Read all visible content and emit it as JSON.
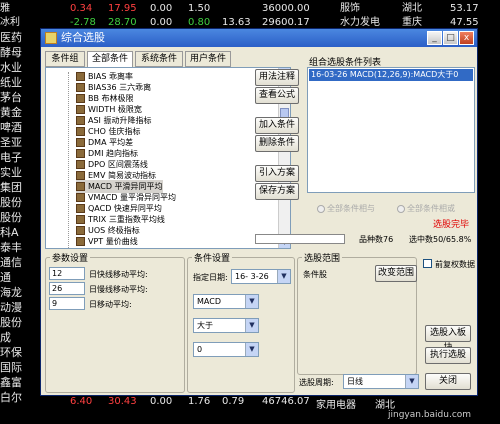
{
  "background_rows": {
    "top_row_1": {
      "name": "雅",
      "c1": "0.34",
      "c2": "17.95",
      "c3": "0.00",
      "c4": "1.50",
      "c5": "36000.00",
      "c6": "服饰",
      "c7": "湖北",
      "c8": "53.17"
    },
    "top_row_2": {
      "name": "冰利",
      "c1": "-2.78",
      "c2": "28.70",
      "c3": "0.00",
      "c4": "0.80",
      "c5": "13.63",
      "c6": "29600.17",
      "c7": "水力发电",
      "c8": "重庆",
      "c9": "47.55"
    },
    "left_names": [
      "冰利",
      "医药",
      "酵母",
      "水业",
      "纸业",
      "茅台",
      "黄金",
      "啤酒",
      "圣亚",
      "电子",
      "实业",
      "集团",
      "股份",
      "股份",
      "科A",
      "泰丰",
      "通信",
      "通",
      "海龙",
      "动漫",
      "股份",
      "成",
      "环保",
      "国际",
      "鑫富",
      "白尔"
    ],
    "bottom_row": {
      "c1": "6.40",
      "c2": "30.43",
      "c3": "0.00",
      "c4": "1.76",
      "c5": "0.79",
      "c6": "46746.07",
      "c7": "家用电器",
      "c8": "湖北",
      "c9": "jingyan.baidu.com"
    }
  },
  "dialog": {
    "title": "综合选股",
    "window_buttons": {
      "min": "_",
      "max": "□",
      "close": "x"
    },
    "tabs": [
      "条件组",
      "全部条件",
      "系统条件",
      "用户条件"
    ],
    "tree_items": [
      "BIAS 乖离率",
      "BIAS36 三六乖离",
      "BB 布林极限",
      "WIDTH 极限宽",
      "ASI 振动升降指标",
      "CHO 佳庆指标",
      "DMA 平均差",
      "DMI 趋向指标",
      "DPO 区间震荡线",
      "EMV 简易波动指标",
      "MACD 平滑异同平均",
      "VMACD 量平滑异同平均",
      "QACD 快速异同平均",
      "TRIX 三重指数平均线",
      "UOS 终极指标",
      "VPT 量价曲线"
    ],
    "side_buttons": [
      "用法注释",
      "查看公式",
      "加入条件",
      "删除条件",
      "引入方案",
      "保存方案"
    ],
    "combo_label": "组合选股条件列表",
    "combo_item": "16-03-26 MACD(12,26,9):MACD大于0",
    "radio_all": "全部条件相与",
    "radio_any": "全部条件相或",
    "status_done": "选股完毕",
    "count_label": "品种数",
    "count_value": "76",
    "selected_label": "选中数",
    "selected_value": "50/65.8%",
    "progress_percent": 0,
    "params": {
      "legend": "参数设置",
      "rows": [
        {
          "value": "12",
          "label": "日快线移动平均:"
        },
        {
          "value": "26",
          "label": "日慢线移动平均:"
        },
        {
          "value": "9",
          "label": "日移动平均:"
        }
      ]
    },
    "conditions": {
      "legend": "条件设置",
      "date_label": "指定日期:",
      "date_value": "16- 3-26",
      "field_value": "MACD",
      "op_value": "大于",
      "num_value": "0"
    },
    "scope": {
      "legend": "选股范围",
      "label": "条件股",
      "change_button": "改变范围",
      "preadj_label": "前复权数据"
    },
    "action_buttons": {
      "add_to_block": "选股入板块",
      "execute": "执行选股",
      "close": "关闭"
    },
    "period_label": "选股周期:",
    "period_value": "日线"
  }
}
